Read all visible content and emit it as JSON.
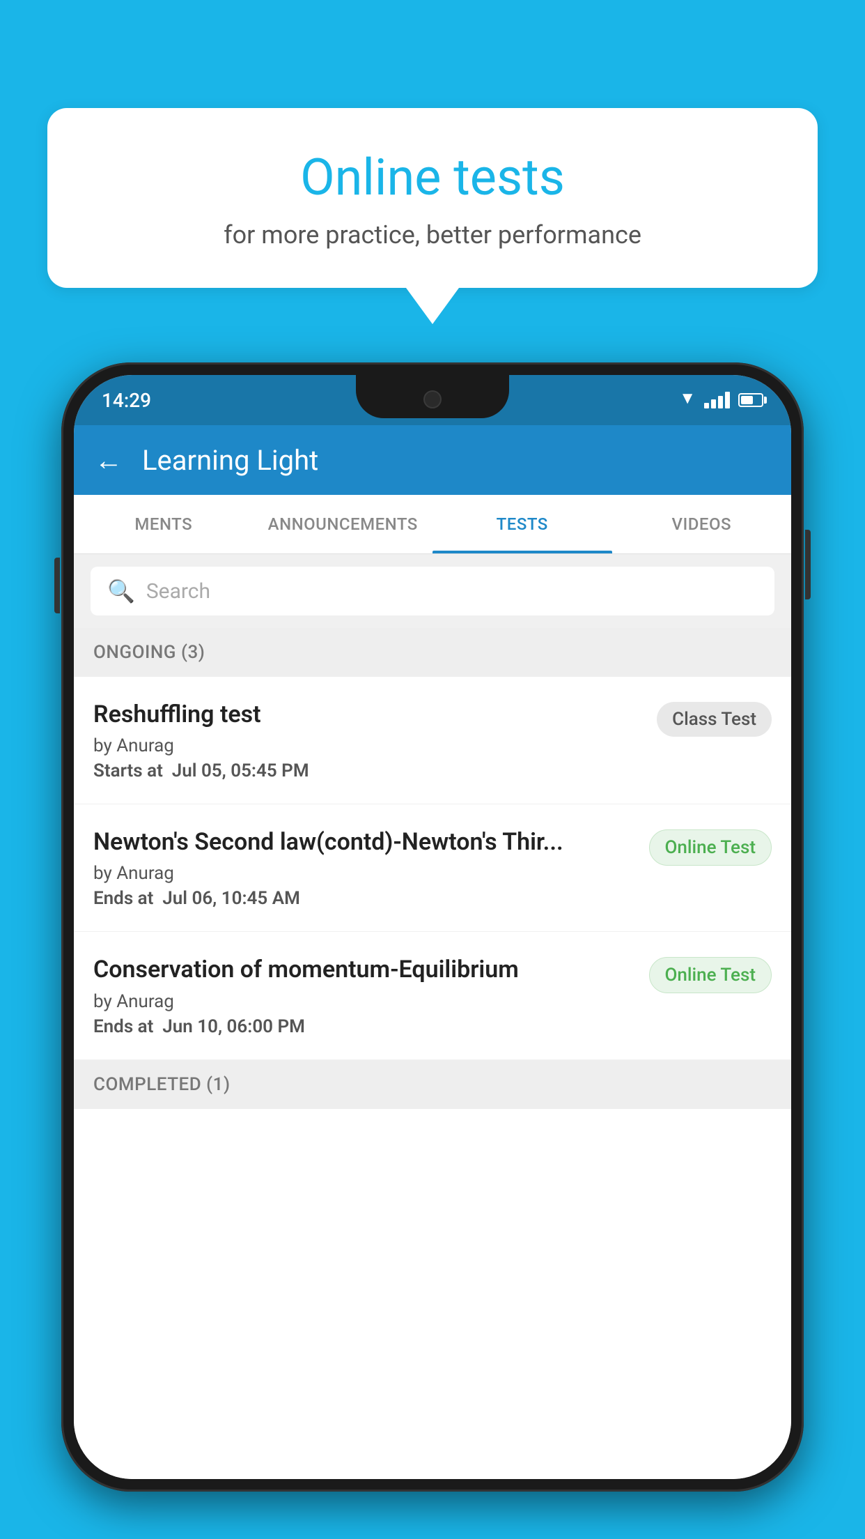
{
  "background_color": "#1ab5e8",
  "speech_bubble": {
    "title": "Online tests",
    "subtitle": "for more practice, better performance"
  },
  "phone": {
    "status_bar": {
      "time": "14:29"
    },
    "app_header": {
      "title": "Learning Light"
    },
    "tabs": [
      {
        "label": "MENTS",
        "active": false
      },
      {
        "label": "ANNOUNCEMENTS",
        "active": false
      },
      {
        "label": "TESTS",
        "active": true
      },
      {
        "label": "VIDEOS",
        "active": false
      }
    ],
    "search": {
      "placeholder": "Search"
    },
    "ongoing_section": {
      "label": "ONGOING (3)"
    },
    "tests": [
      {
        "name": "Reshuffling test",
        "author": "by Anurag",
        "time_label": "Starts at",
        "time_value": "Jul 05, 05:45 PM",
        "badge": "Class Test",
        "badge_type": "class"
      },
      {
        "name": "Newton's Second law(contd)-Newton's Thir...",
        "author": "by Anurag",
        "time_label": "Ends at",
        "time_value": "Jul 06, 10:45 AM",
        "badge": "Online Test",
        "badge_type": "online"
      },
      {
        "name": "Conservation of momentum-Equilibrium",
        "author": "by Anurag",
        "time_label": "Ends at",
        "time_value": "Jun 10, 06:00 PM",
        "badge": "Online Test",
        "badge_type": "online"
      }
    ],
    "completed_section": {
      "label": "COMPLETED (1)"
    }
  }
}
